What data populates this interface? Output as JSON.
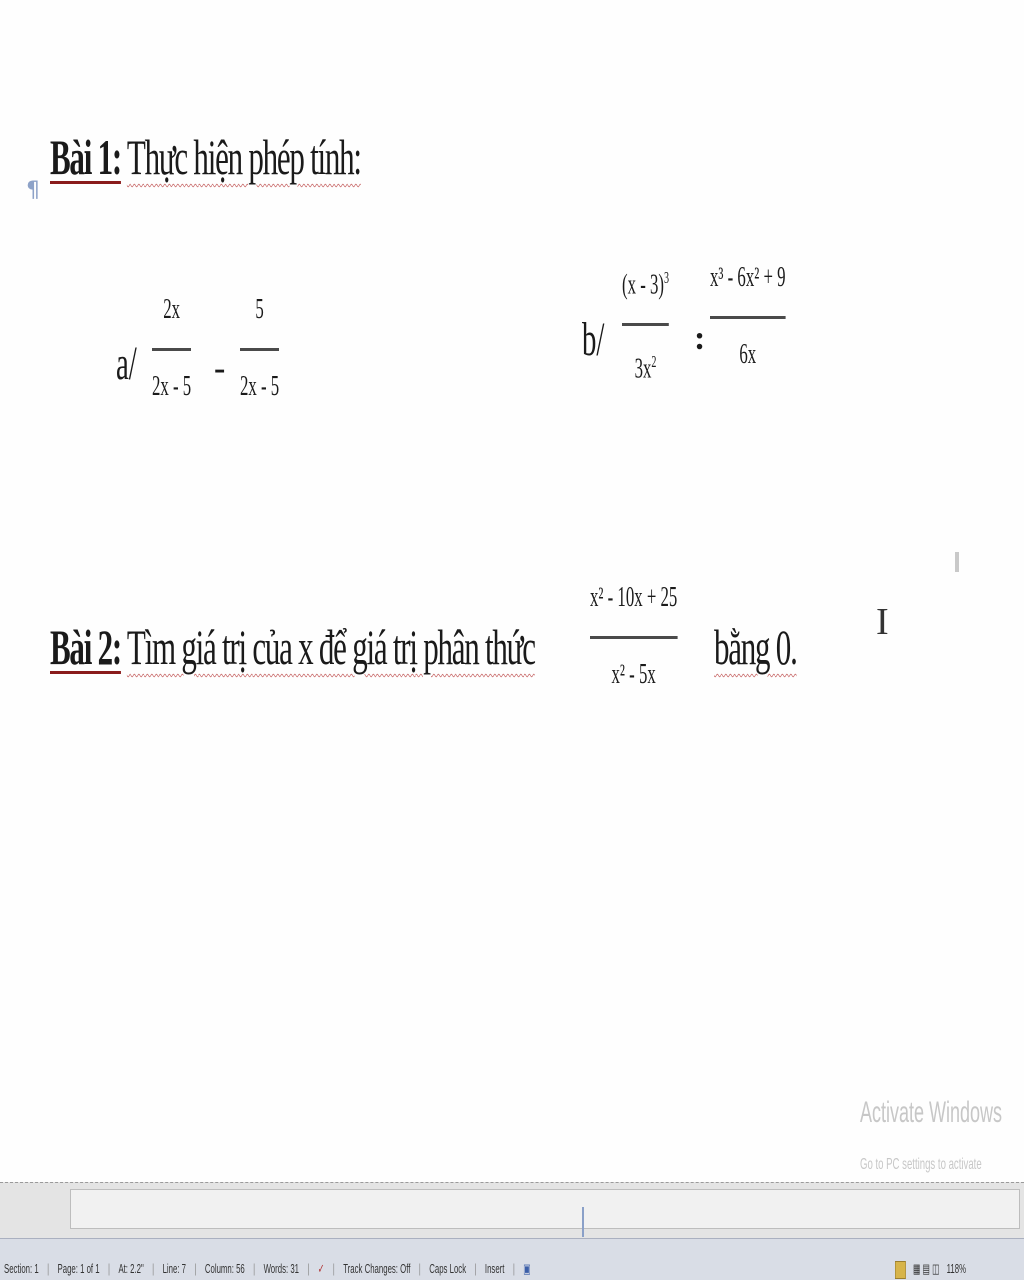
{
  "document": {
    "paragraph_mark": "¶",
    "bai1": {
      "label": "Bài 1:",
      "text": "Thực hiện phép tính:",
      "a": {
        "label": "a/",
        "frac1": {
          "num": "2x",
          "den": "2x - 5"
        },
        "operator": "-",
        "frac2": {
          "num": "5",
          "den": "2x - 5"
        }
      },
      "b": {
        "label": "b/",
        "frac1": {
          "num_base": "(x - 3)",
          "num_exp": "3",
          "den_base": "3x",
          "den_exp": "2"
        },
        "operator": ":",
        "frac2": {
          "num": "x³ - 6x² + 9",
          "den": "6x"
        }
      }
    },
    "bai2": {
      "label": "Bài 2:",
      "text": "Tìm giá trị của x để giá trị phân thức",
      "frac": {
        "num": "x² - 10x + 25",
        "den": "x² - 5x"
      },
      "suffix": "bằng 0."
    },
    "text_cursor": "I"
  },
  "watermark": {
    "line1": "Activate Windows",
    "line2": "Go to PC settings to activate"
  },
  "statusbar": {
    "items": [
      "Section: 1",
      "Page: 1 of 1",
      "At: 2.2\"",
      "Line: 7",
      "Column: 56",
      "Words: 31"
    ],
    "track_changes": "Track Changes: Off",
    "caps_lock": "Caps Lock",
    "insert": "Insert",
    "zoom": "118%"
  },
  "colors": {
    "status_bg": "#d9dde6",
    "heading_underline": "#8a1c1c",
    "spell_underline": "#c96b6b"
  },
  "icons": [
    "paragraph-mark-icon",
    "text-cursor-icon",
    "spelling-check-icon",
    "macro-record-icon",
    "layout-view-icon"
  ]
}
